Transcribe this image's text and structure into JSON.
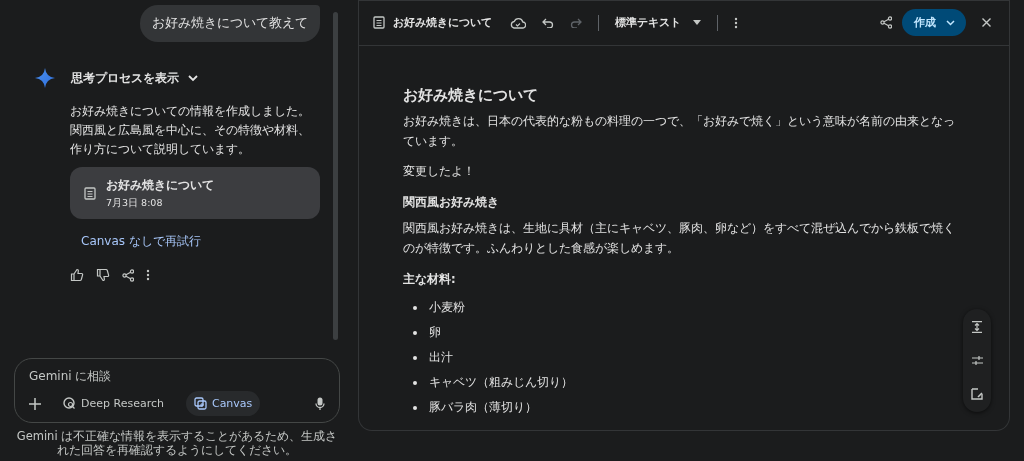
{
  "chat": {
    "user_message": "お好み焼きについて教えて",
    "thinking_toggle": {
      "label": "思考プロセスを表示",
      "expanded": false
    },
    "response": "お好み焼きについての情報を作成しました。関西風と広島風を中心に、その特徴や材料、作り方について説明しています。",
    "document_card": {
      "title": "お好み焼きについて",
      "timestamp": "7月3日 8:08"
    },
    "retry_link": "Canvas なしで再試行"
  },
  "composer": {
    "placeholder": "Gemini に相談",
    "tools": [
      {
        "kind": "research",
        "label": "Deep Research",
        "selected": false
      },
      {
        "kind": "canvas",
        "label": "Canvas",
        "selected": true
      }
    ]
  },
  "disclaimer": "Gemini は不正確な情報を表示することがあるため、生成された回答を再確認するようにしてください。",
  "editor": {
    "doc_title": "お好み焼きについて",
    "undo_disabled": false,
    "redo_disabled": true,
    "text_style": "標準テキスト",
    "create_button": "作成",
    "content": [
      {
        "kind": "title",
        "text": "お好み焼きについて"
      },
      {
        "kind": "paragraph",
        "text": "お好み焼きは、日本の代表的な粉もの料理の一つで、「お好みで焼く」という意味が名前の由来となっています。"
      },
      {
        "kind": "paragraph",
        "text": "変更したよ！"
      },
      {
        "kind": "heading",
        "text": "関西風お好み焼き"
      },
      {
        "kind": "paragraph",
        "text": "関西風お好み焼きは、生地に具材（主にキャベツ、豚肉、卵など）をすべて混ぜ込んでから鉄板で焼くのが特徴です。ふんわりとした食感が楽しめます。"
      },
      {
        "kind": "heading",
        "text": "主な材料:"
      },
      {
        "kind": "list",
        "items": [
          "小麦粉",
          "卵",
          "出汁",
          "キャベツ（粗みじん切り）",
          "豚バラ肉（薄切り）"
        ]
      }
    ]
  }
}
